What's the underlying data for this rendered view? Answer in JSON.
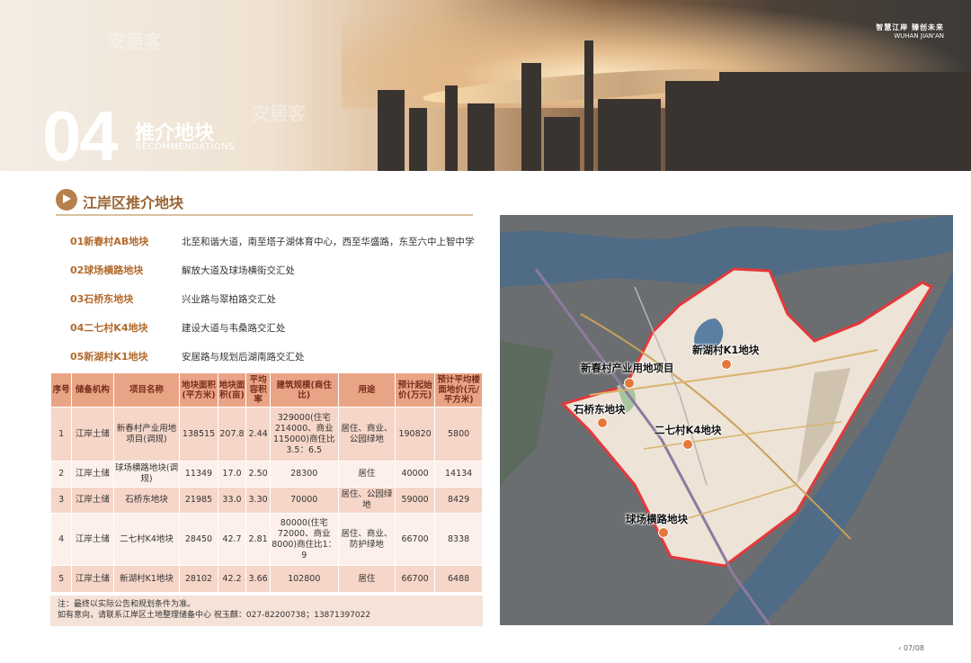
{
  "banner": {
    "number": "04",
    "title": "推介地块",
    "subtitle": "RECOMMENDATIONS",
    "logo_cn": "智慧江岸 臻创未来",
    "logo_en": "WUHAN JIAN'AN"
  },
  "section": {
    "title": "江岸区推介地块"
  },
  "plots": [
    {
      "name": "01新春村AB地块",
      "addr": "北至和谐大道，南至塔子湖体育中心，西至华盛路，东至六中上智中学"
    },
    {
      "name": "02球场横路地块",
      "addr": "解放大道及球场横街交汇处"
    },
    {
      "name": "03石桥东地块",
      "addr": "兴业路与翠柏路交汇处"
    },
    {
      "name": "04二七村K4地块",
      "addr": "建设大道与韦桑路交汇处"
    },
    {
      "name": "05新湖村K1地块",
      "addr": "安居路与规划后湖南路交汇处"
    }
  ],
  "table": {
    "headers": [
      "序号",
      "储备机构",
      "项目名称",
      "地块面积(平方米)",
      "地块面积(亩)",
      "平均容积率",
      "建筑规模(商住比)",
      "用途",
      "预计起始价(万元)",
      "预计平均楼面地价(元/平方米)"
    ],
    "rows": [
      [
        "1",
        "江岸土储",
        "新春村产业用地项目(调规)",
        "138515",
        "207.8",
        "2.44",
        "329000(住宅214000、商业115000)商住比3.5：6.5",
        "居住、商业、公园绿地",
        "190820",
        "5800"
      ],
      [
        "2",
        "江岸土储",
        "球场横路地块(调规)",
        "11349",
        "17.0",
        "2.50",
        "28300",
        "居住",
        "40000",
        "14134"
      ],
      [
        "3",
        "江岸土储",
        "石桥东地块",
        "21985",
        "33.0",
        "3.30",
        "70000",
        "居住、公园绿地",
        "59000",
        "8429"
      ],
      [
        "4",
        "江岸土储",
        "二七村K4地块",
        "28450",
        "42.7",
        "2.81",
        "80000(住宅72000、商业8000)商住比1：9",
        "居住、商业、防护绿地",
        "66700",
        "8338"
      ],
      [
        "5",
        "江岸土储",
        "新湖村K1地块",
        "28102",
        "42.2",
        "3.66",
        "102800",
        "居住",
        "66700",
        "6488"
      ]
    ]
  },
  "notes": {
    "line1": "注：最终以实际公告和规划条件为准。",
    "line2": "如有意向，请联系江岸区土地整理储备中心  祝玉麒：027-82200738；13871397022"
  },
  "map": {
    "labels": [
      "新湖村K1地块",
      "新春村产业用地项目",
      "石桥东地块",
      "二七村K4地块",
      "球场横路地块"
    ]
  },
  "pager": "07/08",
  "watermark": "安居客"
}
